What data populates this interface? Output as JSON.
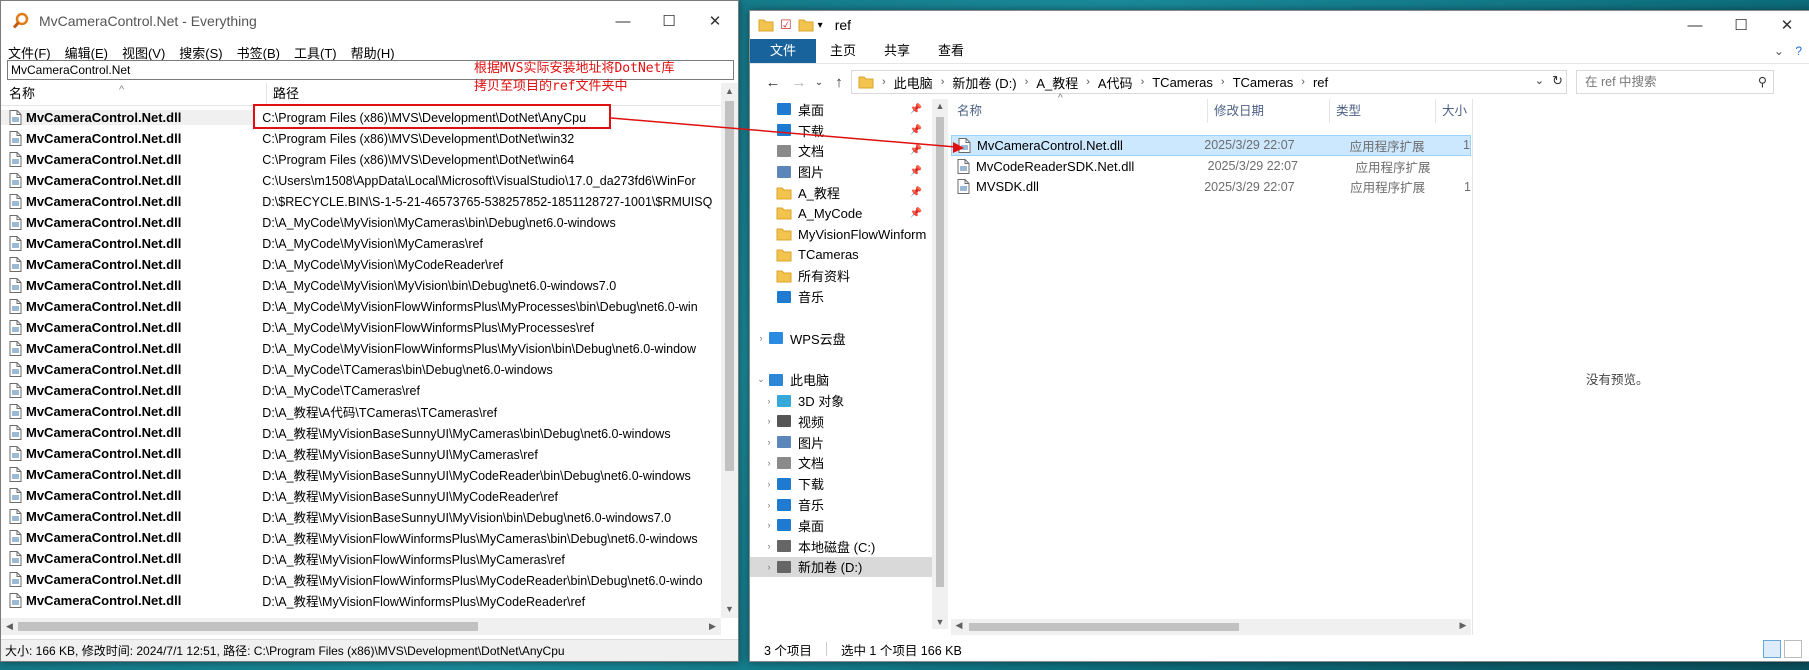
{
  "everything": {
    "title": "MvCameraControl.Net - Everything",
    "menu": [
      "文件(F)",
      "编辑(E)",
      "视图(V)",
      "搜索(S)",
      "书签(B)",
      "工具(T)",
      "帮助(H)"
    ],
    "search_value": "MvCameraControl.Net",
    "columns": {
      "name": "名称",
      "path": "路径"
    },
    "rows": [
      {
        "name": "MvCameraControl.Net.dll",
        "path": "C:\\Program Files (x86)\\MVS\\Development\\DotNet\\AnyCpu"
      },
      {
        "name": "MvCameraControl.Net.dll",
        "path": "C:\\Program Files (x86)\\MVS\\Development\\DotNet\\win32"
      },
      {
        "name": "MvCameraControl.Net.dll",
        "path": "C:\\Program Files (x86)\\MVS\\Development\\DotNet\\win64"
      },
      {
        "name": "MvCameraControl.Net.dll",
        "path": "C:\\Users\\m1508\\AppData\\Local\\Microsoft\\VisualStudio\\17.0_da273fd6\\WinFor"
      },
      {
        "name": "MvCameraControl.Net.dll",
        "path": "D:\\$RECYCLE.BIN\\S-1-5-21-46573765-538257852-1851128727-1001\\$RMUISQ"
      },
      {
        "name": "MvCameraControl.Net.dll",
        "path": "D:\\A_MyCode\\MyVision\\MyCameras\\bin\\Debug\\net6.0-windows"
      },
      {
        "name": "MvCameraControl.Net.dll",
        "path": "D:\\A_MyCode\\MyVision\\MyCameras\\ref"
      },
      {
        "name": "MvCameraControl.Net.dll",
        "path": "D:\\A_MyCode\\MyVision\\MyCodeReader\\ref"
      },
      {
        "name": "MvCameraControl.Net.dll",
        "path": "D:\\A_MyCode\\MyVision\\MyVision\\bin\\Debug\\net6.0-windows7.0"
      },
      {
        "name": "MvCameraControl.Net.dll",
        "path": "D:\\A_MyCode\\MyVisionFlowWinformsPlus\\MyProcesses\\bin\\Debug\\net6.0-win"
      },
      {
        "name": "MvCameraControl.Net.dll",
        "path": "D:\\A_MyCode\\MyVisionFlowWinformsPlus\\MyProcesses\\ref"
      },
      {
        "name": "MvCameraControl.Net.dll",
        "path": "D:\\A_MyCode\\MyVisionFlowWinformsPlus\\MyVision\\bin\\Debug\\net6.0-window"
      },
      {
        "name": "MvCameraControl.Net.dll",
        "path": "D:\\A_MyCode\\TCameras\\bin\\Debug\\net6.0-windows"
      },
      {
        "name": "MvCameraControl.Net.dll",
        "path": "D:\\A_MyCode\\TCameras\\ref"
      },
      {
        "name": "MvCameraControl.Net.dll",
        "path": "D:\\A_教程\\A代码\\TCameras\\TCameras\\ref"
      },
      {
        "name": "MvCameraControl.Net.dll",
        "path": "D:\\A_教程\\MyVisionBaseSunnyUI\\MyCameras\\bin\\Debug\\net6.0-windows"
      },
      {
        "name": "MvCameraControl.Net.dll",
        "path": "D:\\A_教程\\MyVisionBaseSunnyUI\\MyCameras\\ref"
      },
      {
        "name": "MvCameraControl.Net.dll",
        "path": "D:\\A_教程\\MyVisionBaseSunnyUI\\MyCodeReader\\bin\\Debug\\net6.0-windows"
      },
      {
        "name": "MvCameraControl.Net.dll",
        "path": "D:\\A_教程\\MyVisionBaseSunnyUI\\MyCodeReader\\ref"
      },
      {
        "name": "MvCameraControl.Net.dll",
        "path": "D:\\A_教程\\MyVisionBaseSunnyUI\\MyVision\\bin\\Debug\\net6.0-windows7.0"
      },
      {
        "name": "MvCameraControl.Net.dll",
        "path": "D:\\A_教程\\MyVisionFlowWinformsPlus\\MyCameras\\bin\\Debug\\net6.0-windows"
      },
      {
        "name": "MvCameraControl.Net.dll",
        "path": "D:\\A_教程\\MyVisionFlowWinformsPlus\\MyCameras\\ref"
      },
      {
        "name": "MvCameraControl.Net.dll",
        "path": "D:\\A_教程\\MyVisionFlowWinformsPlus\\MyCodeReader\\bin\\Debug\\net6.0-windo"
      },
      {
        "name": "MvCameraControl.Net.dll",
        "path": "D:\\A_教程\\MyVisionFlowWinformsPlus\\MyCodeReader\\ref"
      }
    ],
    "status": "大小: 166 KB, 修改时间: 2024/7/1 12:51, 路径: C:\\Program Files (x86)\\MVS\\Development\\DotNet\\AnyCpu"
  },
  "annotation": {
    "line1": "根据MVS实际安装地址将DotNet库",
    "line2": "拷贝至项目的ref文件夹中",
    "color": "#e01010"
  },
  "explorer": {
    "title": "ref",
    "ribbon_tabs": [
      "文件",
      "主页",
      "共享",
      "查看"
    ],
    "breadcrumb": [
      "此电脑",
      "新加卷 (D:)",
      "A_教程",
      "A代码",
      "TCameras",
      "TCameras",
      "ref"
    ],
    "search_placeholder": "在 ref 中搜索",
    "nav_items": [
      {
        "label": "桌面",
        "icon": "desktop-icon",
        "pinned": true,
        "expander": ""
      },
      {
        "label": "下载",
        "icon": "download-icon",
        "pinned": true,
        "expander": ""
      },
      {
        "label": "文档",
        "icon": "document-icon",
        "pinned": true,
        "expander": ""
      },
      {
        "label": "图片",
        "icon": "picture-icon",
        "pinned": true,
        "expander": ""
      },
      {
        "label": "A_教程",
        "icon": "folder-icon",
        "pinned": true,
        "expander": ""
      },
      {
        "label": "A_MyCode",
        "icon": "folder-icon",
        "pinned": true,
        "expander": ""
      },
      {
        "label": "MyVisionFlowWinform",
        "icon": "folder-icon",
        "pinned": false,
        "expander": ""
      },
      {
        "label": "TCameras",
        "icon": "folder-icon",
        "pinned": false,
        "expander": ""
      },
      {
        "label": "所有资料",
        "icon": "folder-icon",
        "pinned": false,
        "expander": ""
      },
      {
        "label": "音乐",
        "icon": "music-icon",
        "pinned": false,
        "expander": ""
      },
      {
        "label": "",
        "icon": "",
        "pinned": false,
        "expander": "",
        "spacer": true
      },
      {
        "label": "WPS云盘",
        "icon": "cloud-icon",
        "pinned": false,
        "expander": "›",
        "level": 0
      },
      {
        "label": "",
        "icon": "",
        "pinned": false,
        "expander": "",
        "spacer": true
      },
      {
        "label": "此电脑",
        "icon": "computer-icon",
        "pinned": false,
        "expander": "⌄",
        "level": 0
      },
      {
        "label": "3D 对象",
        "icon": "cube-icon",
        "pinned": false,
        "expander": "›"
      },
      {
        "label": "视频",
        "icon": "video-icon",
        "pinned": false,
        "expander": "›"
      },
      {
        "label": "图片",
        "icon": "picture-icon",
        "pinned": false,
        "expander": "›"
      },
      {
        "label": "文档",
        "icon": "document-icon",
        "pinned": false,
        "expander": "›"
      },
      {
        "label": "下载",
        "icon": "download-icon",
        "pinned": false,
        "expander": "›"
      },
      {
        "label": "音乐",
        "icon": "music-icon",
        "pinned": false,
        "expander": "›"
      },
      {
        "label": "桌面",
        "icon": "desktop-icon",
        "pinned": false,
        "expander": "›"
      },
      {
        "label": "本地磁盘 (C:)",
        "icon": "drive-icon",
        "pinned": false,
        "expander": "›"
      },
      {
        "label": "新加卷 (D:)",
        "icon": "drive-icon",
        "pinned": false,
        "expander": "›",
        "selected": true
      }
    ],
    "columns": {
      "name": "名称",
      "date": "修改日期",
      "type": "类型",
      "size": "大小"
    },
    "files": [
      {
        "name": "MvCameraControl.Net.dll",
        "date": "2025/3/29 22:07",
        "type": "应用程序扩展",
        "size": "1",
        "selected": true
      },
      {
        "name": "MvCodeReaderSDK.Net.dll",
        "date": "2025/3/29 22:07",
        "type": "应用程序扩展",
        "size": ""
      },
      {
        "name": "MVSDK.dll",
        "date": "2025/3/29 22:07",
        "type": "应用程序扩展",
        "size": "1"
      }
    ],
    "preview_text": "没有预览。",
    "status": {
      "count": "3 个项目",
      "selection": "选中 1 个项目  166 KB"
    }
  }
}
